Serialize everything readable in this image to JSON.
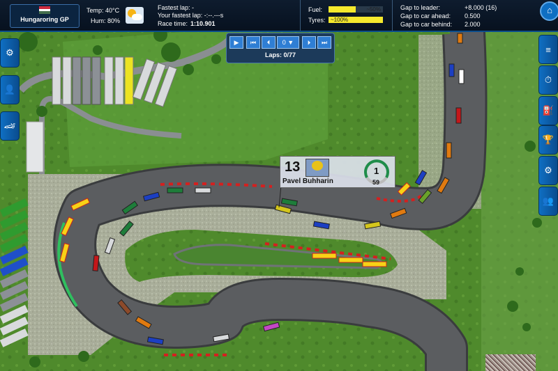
{
  "race": {
    "gp_name": "Hungaroring GP",
    "temp": "Temp: 40°C",
    "hum": "Hum: 80%",
    "fastest_lap": "Fastest lap: -",
    "your_fastest_lap": "Your fastest lap: -:--.---s",
    "race_time_label": "Race time:",
    "race_time_value": "1:10.901",
    "fuel_label": "Fuel:",
    "fuel_value": "~50%",
    "fuel_level": 0.5,
    "tyres_label": "Tyres:",
    "tyres_value": "~100%",
    "tyres_level": 1.0,
    "gap_leader_label": "Gap to leader:",
    "gap_leader_value": "+8.000 (16)",
    "gap_ahead_label": "Gap to car ahead:",
    "gap_ahead_value": "0.500",
    "gap_behind_label": "Gap to car behind:",
    "gap_behind_value": "2.000"
  },
  "controls": {
    "play": "▶",
    "rewind": "⏮",
    "step_back": "⏴",
    "speed_value": "0",
    "speed_dropdown": "▼",
    "step_fwd": "⏵",
    "ffwd": "⏭",
    "laps": "Laps: 0/77"
  },
  "driver": {
    "number": "13",
    "name": "Pavel Buhharin",
    "position": "1",
    "speed": "59"
  },
  "icons": {
    "home": "⌂",
    "left": [
      "⚙",
      "👤",
      "🏎"
    ],
    "right": [
      "≡",
      "⏱",
      "⛽",
      "🏆",
      "⚙",
      "👥"
    ]
  },
  "colors": {
    "accent": "#0f6fc3",
    "topbar": "#0e1c2e",
    "bar_yellow": "#f5e92d",
    "asphalt": "#5b5d60",
    "grass": "#4f8a2c"
  }
}
